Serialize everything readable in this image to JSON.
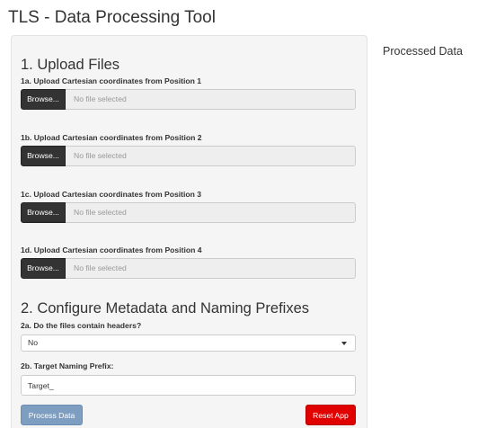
{
  "app": {
    "title": "TLS - Data Processing Tool"
  },
  "upload": {
    "heading": "1. Upload Files",
    "fields": [
      {
        "label": "1a. Upload Cartesian coordinates from Position 1",
        "button": "Browse...",
        "placeholder": "No file selected"
      },
      {
        "label": "1b. Upload Cartesian coordinates from Position 2",
        "button": "Browse...",
        "placeholder": "No file selected"
      },
      {
        "label": "1c. Upload Cartesian coordinates from Position 3",
        "button": "Browse...",
        "placeholder": "No file selected"
      },
      {
        "label": "1d. Upload Cartesian coordinates from Position 4",
        "button": "Browse...",
        "placeholder": "No file selected"
      }
    ]
  },
  "metadata": {
    "heading": "2. Configure Metadata and Naming Prefixes",
    "headers_label": "2a. Do the files contain headers?",
    "headers_value": "No",
    "prefix_label": "2b. Target Naming Prefix:",
    "prefix_value": "Target_"
  },
  "actions": {
    "process_label": "Process Data",
    "reset_label": "Reset App",
    "process_color": "#7d9ec0",
    "reset_color": "#e10000"
  },
  "output": {
    "title": "Processed Data"
  },
  "icons": {
    "select_caret": "caret-down-icon"
  }
}
